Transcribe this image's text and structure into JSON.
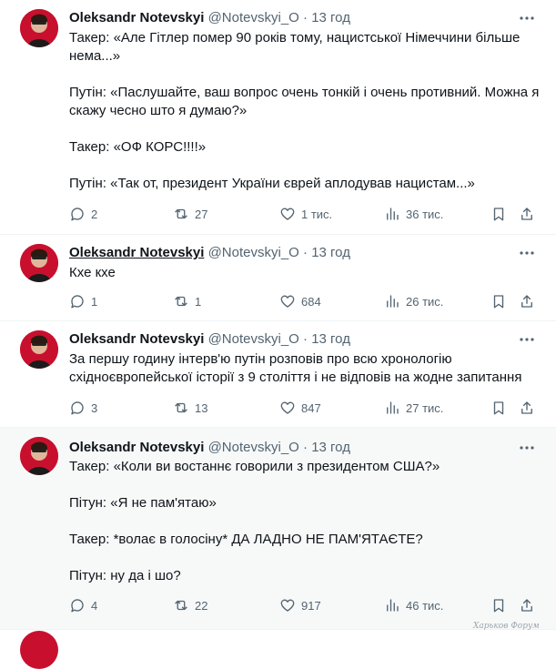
{
  "tweets": [
    {
      "author": "Oleksandr Notevskyi",
      "handle": "@Notevskyi_O",
      "time": "13 год",
      "lines": [
        "Такер: «Але Гітлер помер 90 років тому, нацистської Німеччини більше нема...»",
        "",
        "Путін: «Паслушайте, ваш вопрос очень тонкій і очень противний. Можна я скажу чесно што я думаю?»",
        "",
        "Такер: «ОФ КОРС!!!!»",
        "",
        "Путін: «Так от, президент України єврей аплодував нацистам...»"
      ],
      "replies": "2",
      "reposts": "27",
      "likes": "1 тис.",
      "views": "36 тис."
    },
    {
      "author": "Oleksandr Notevskyi",
      "handle": "@Notevskyi_O",
      "time": "13 год",
      "lines": [
        "Кхе кхе"
      ],
      "replies": "1",
      "reposts": "1",
      "likes": "684",
      "views": "26 тис."
    },
    {
      "author": "Oleksandr Notevskyi",
      "handle": "@Notevskyi_O",
      "time": "13 год",
      "lines": [
        "За першу годину інтерв'ю путін розповів про всю хронологію",
        "східноєвропейської історії з 9 століття і не відповів на жодне запитання"
      ],
      "replies": "3",
      "reposts": "13",
      "likes": "847",
      "views": "27 тис."
    },
    {
      "author": "Oleksandr Notevskyi",
      "handle": "@Notevskyi_O",
      "time": "13 год",
      "lines": [
        "Такер: «Коли ви востаннє говорили з президентом США?»",
        "",
        "Пітун: «Я не пам'ятаю»",
        "",
        "Такер: *волає в голосіну* ДА ЛАДНО НЕ ПАМ'ЯТАЄТЕ?",
        "",
        "Пітун: ну да і шо?"
      ],
      "replies": "4",
      "reposts": "22",
      "likes": "917",
      "views": "46 тис."
    }
  ],
  "separator": "·",
  "watermark": "Харьков Форум",
  "colors": {
    "text": "#0f1419",
    "muted": "#536471",
    "highlight_bg": "#f7f9f9",
    "avatar": "#c8102e"
  },
  "icons": {
    "reply": "reply-icon",
    "repost": "repost-icon",
    "like": "heart-icon",
    "views": "views-chart-icon",
    "bookmark": "bookmark-icon",
    "share": "share-icon",
    "more": "more-icon"
  }
}
